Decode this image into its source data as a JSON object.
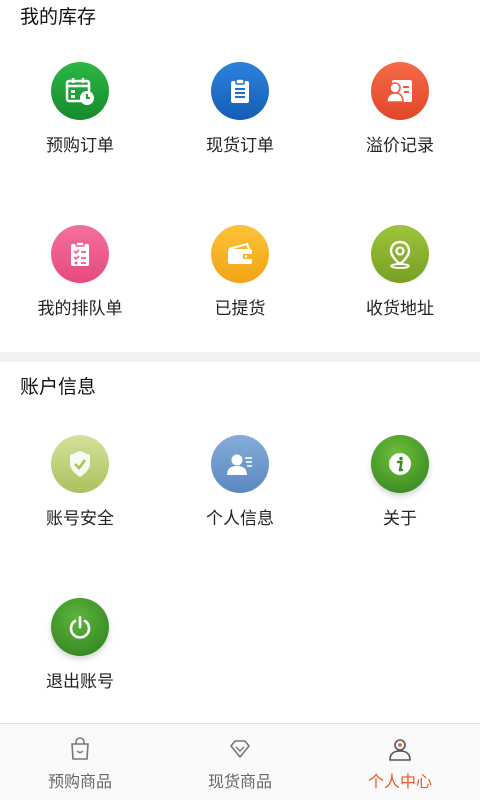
{
  "inventory": {
    "title": "我的库存",
    "items": [
      {
        "label": "预购订单",
        "icon": "calendar-clock-icon",
        "color": "#1fa33a"
      },
      {
        "label": "现货订单",
        "icon": "clipboard-icon",
        "color": "#1e6fc9"
      },
      {
        "label": "溢价记录",
        "icon": "id-card-icon",
        "color": "#f0593a"
      },
      {
        "label": "我的排队单",
        "icon": "checklist-icon",
        "color": "#ee5d8f"
      },
      {
        "label": "已提货",
        "icon": "wallet-icon",
        "color": "#f7b325"
      },
      {
        "label": "收货地址",
        "icon": "location-pin-icon",
        "color": "#8bb52e"
      }
    ]
  },
  "account": {
    "title": "账户信息",
    "items": [
      {
        "label": "账号安全",
        "icon": "shield-check-icon",
        "color": "#bcd07a"
      },
      {
        "label": "个人信息",
        "icon": "user-card-icon",
        "color": "#6f9bcf"
      },
      {
        "label": "关于",
        "icon": "info-icon",
        "color": "#4a9a2a"
      },
      {
        "label": "退出账号",
        "icon": "power-icon",
        "color": "#3f9a2b"
      }
    ]
  },
  "tabbar": {
    "tabs": [
      {
        "label": "预购商品",
        "icon": "shopping-bag-icon"
      },
      {
        "label": "现货商品",
        "icon": "diamond-icon"
      },
      {
        "label": "个人中心",
        "icon": "person-icon",
        "active": true
      }
    ],
    "active_color": "#e8582a"
  }
}
